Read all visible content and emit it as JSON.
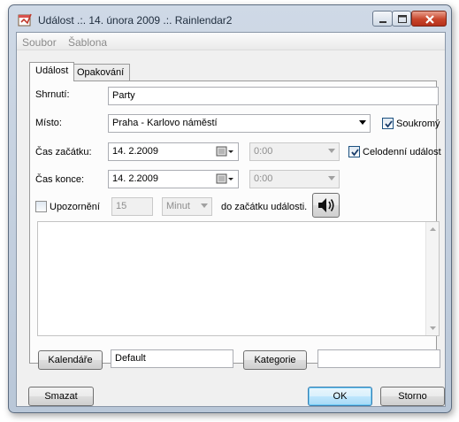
{
  "window": {
    "title": "Událost .:. 14. února 2009 .:. Rainlendar2"
  },
  "menu": [
    "Soubor",
    "Šablona"
  ],
  "tabs": [
    {
      "label": "Událost",
      "active": true
    },
    {
      "label": "Opakování",
      "active": false
    }
  ],
  "form": {
    "summary_label": "Shrnutí:",
    "summary_value": "Party",
    "location_label": "Místo:",
    "location_value": "Praha - Karlovo náměstí",
    "private_label": "Soukromý",
    "private_checked": true,
    "start_label": "Čas začátku:",
    "start_date": "14.  2.2009",
    "start_time": "0:00",
    "allday_label": "Celodenní událost",
    "allday_checked": true,
    "end_label": "Čas konce:",
    "end_date": "14.  2.2009",
    "end_time": "0:00",
    "alarm_label": "Upozornění",
    "alarm_checked": false,
    "alarm_value": "15",
    "alarm_unit": "Minut",
    "alarm_suffix": "do začátku události.",
    "description": ""
  },
  "bottom": {
    "calendars_button": "Kalendáře",
    "calendar_value": "Default",
    "categories_button": "Kategorie",
    "categories_value": ""
  },
  "footer": {
    "delete_button": "Smazat",
    "ok_button": "OK",
    "cancel_button": "Storno"
  },
  "colors": {
    "window_frame": "#b9c7d8",
    "panel": "#fcfcfc",
    "default_button": "#a7d9f5",
    "close_button": "#c8452b"
  }
}
